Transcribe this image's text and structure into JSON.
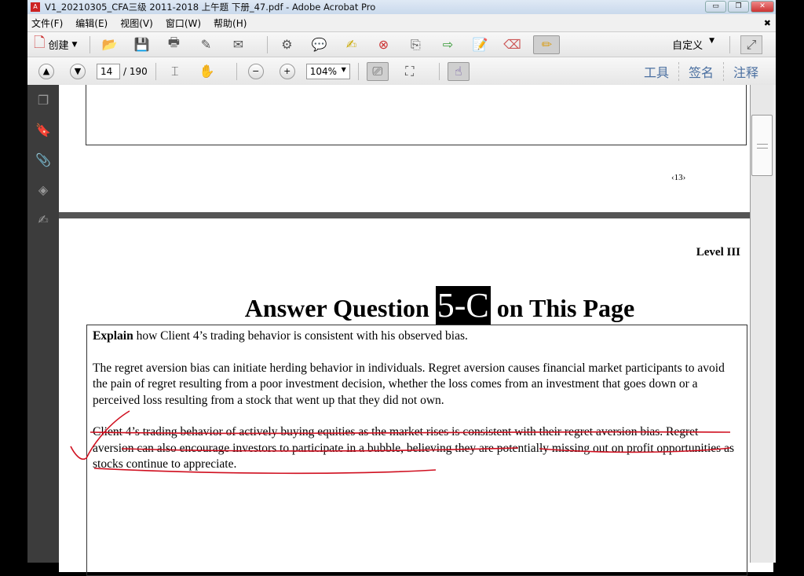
{
  "window": {
    "title": "V1_20210305_CFA三级 2011-2018 上午题  下册_47.pdf - Adobe Acrobat Pro",
    "minimize": "▭",
    "restore": "❐",
    "close": "✕"
  },
  "menu": [
    "文件(F)",
    "编辑(E)",
    "视图(V)",
    "窗口(W)",
    "帮助(H)"
  ],
  "menu_close": "✖",
  "toolbar": {
    "create_label": "创建",
    "customize_label": "自定义"
  },
  "nav": {
    "page_current": "14",
    "page_total": "/ 190",
    "zoom": "104%",
    "tools": "工具",
    "sign": "签名",
    "comment": "注释"
  },
  "page1": {
    "page_number": "‹13›"
  },
  "page2": {
    "level": "Level III",
    "heading_pre": "Answer Question ",
    "heading_code": "5-C",
    "heading_post": " on This Page",
    "prompt_bold": "Explain",
    "prompt_rest": " how Client 4’s trading behavior is consistent with his observed bias.",
    "para1": "The regret aversion bias can initiate herding behavior in individuals. Regret aversion causes financial market participants to avoid the pain of regret resulting from a poor investment decision, whether the loss comes from an investment that goes down or a perceived loss resulting from a stock that went up that they did not own.",
    "para2": "Client 4’s trading behavior of actively buying equities as the market rises is consistent with their regret aversion bias. Regret aversion can also encourage investors to participate in a bubble, believing they are potentially missing out on profit opportunities as stocks continue to appreciate."
  },
  "colors": {
    "ink": "#d01020",
    "link": "#4a6fa0"
  }
}
